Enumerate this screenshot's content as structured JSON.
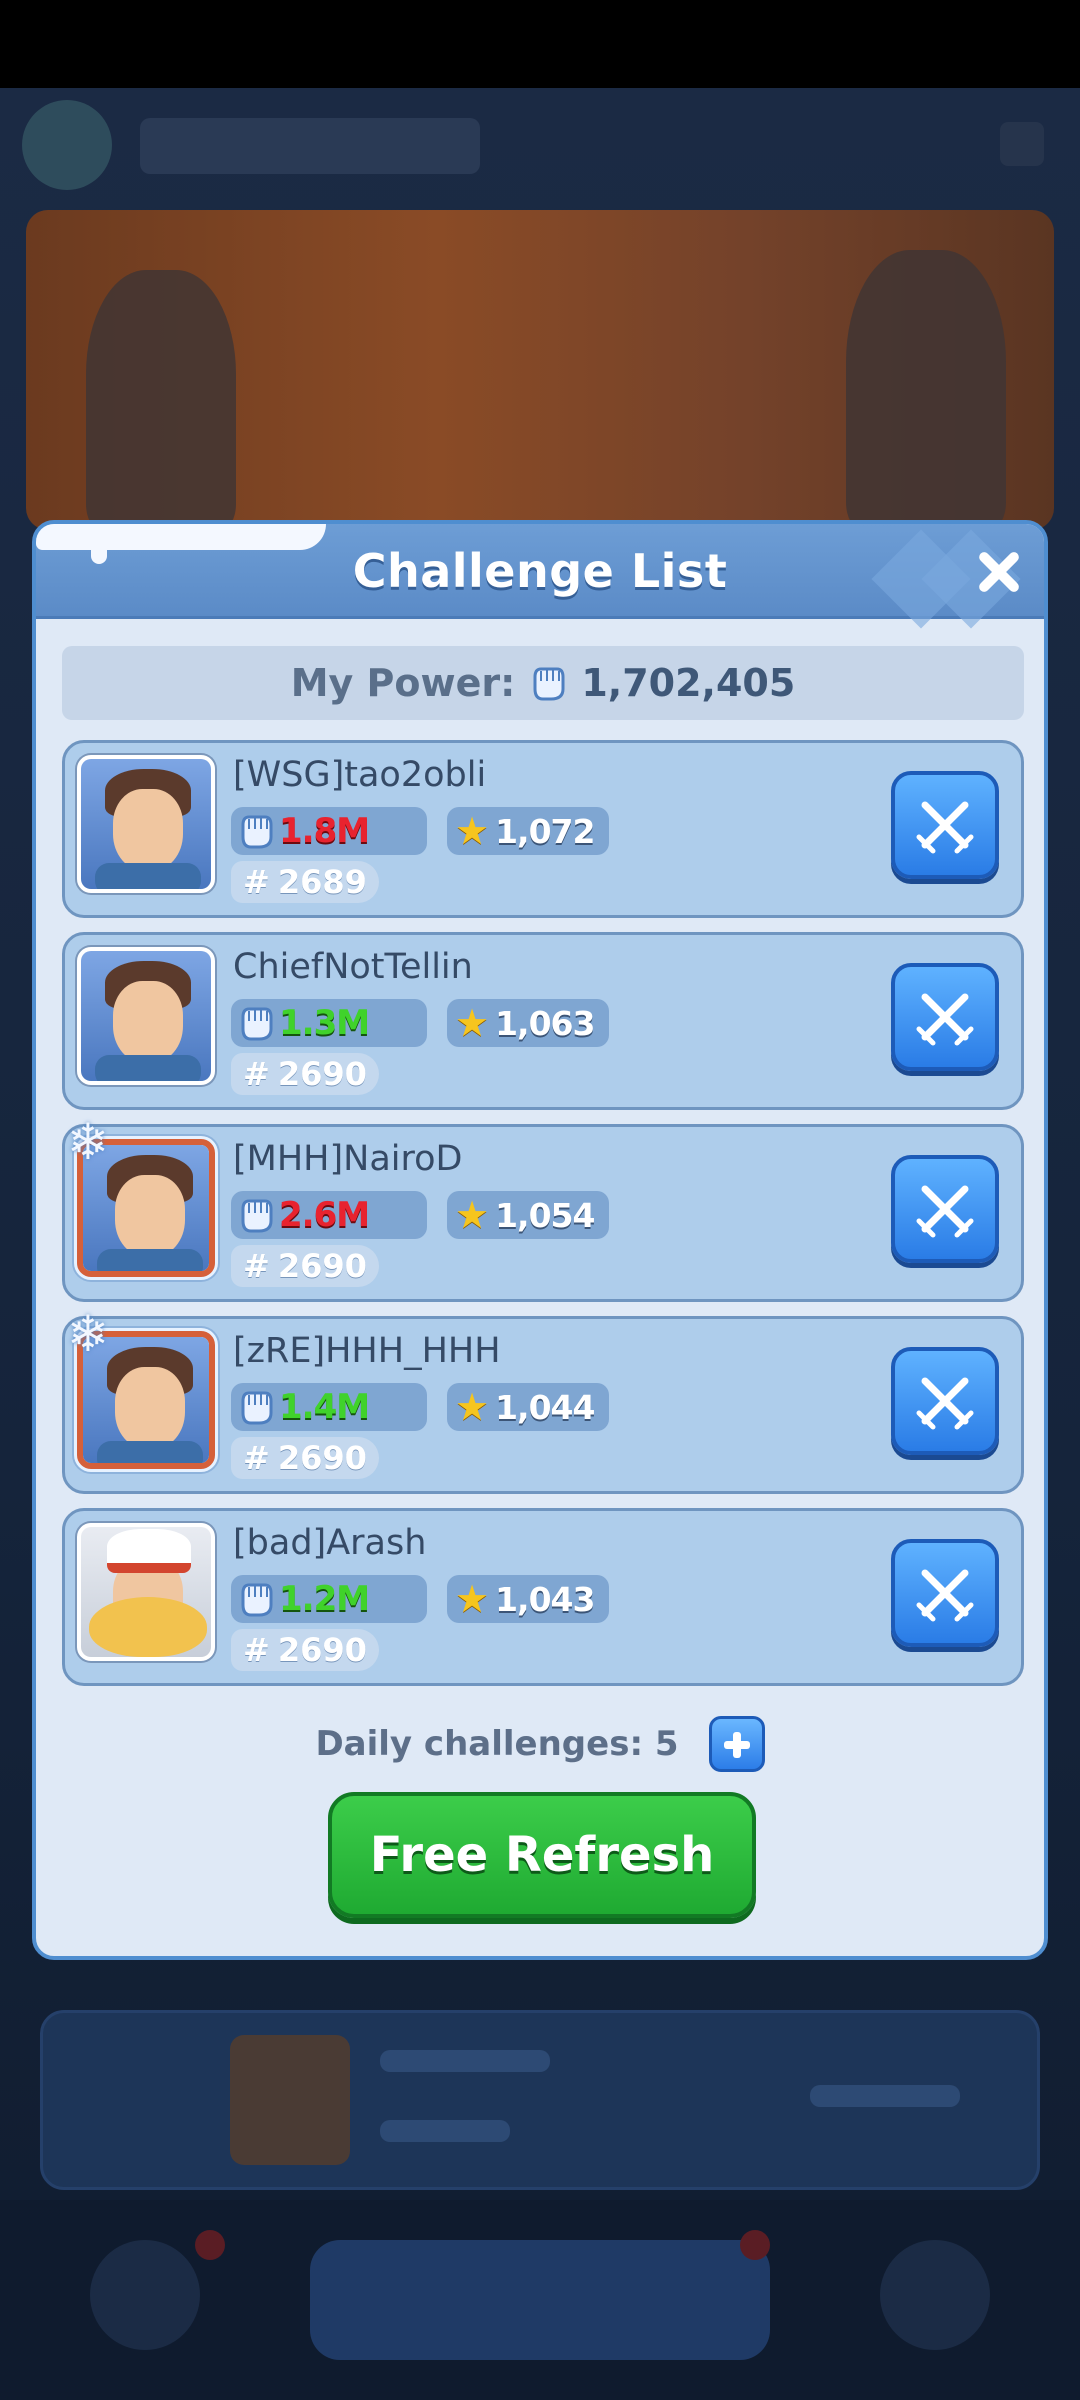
{
  "dialog": {
    "title": "Challenge List",
    "my_power_label": "My Power:",
    "my_power_value": "1,702,405",
    "daily_challenges": "Daily challenges: 5",
    "refresh_label": "Free Refresh"
  },
  "players": [
    {
      "name": "[WSG]tao2obli",
      "power": "1.8M",
      "power_color": "red",
      "stars": "1,072",
      "rank": "2689",
      "avatar": "hero",
      "frame": "plain"
    },
    {
      "name": "ChiefNotTellin",
      "power": "1.3M",
      "power_color": "green",
      "stars": "1,063",
      "rank": "2690",
      "avatar": "hero",
      "frame": "plain"
    },
    {
      "name": "[MHH]NairoD",
      "power": "2.6M",
      "power_color": "red",
      "stars": "1,054",
      "rank": "2690",
      "avatar": "hero",
      "frame": "frost"
    },
    {
      "name": "[zRE]HHH_HHH",
      "power": "1.4M",
      "power_color": "green",
      "stars": "1,044",
      "rank": "2690",
      "avatar": "hero",
      "frame": "frost"
    },
    {
      "name": "[bad]Arash",
      "power": "1.2M",
      "power_color": "green",
      "stars": "1,043",
      "rank": "2690",
      "avatar": "chef",
      "frame": "plain"
    }
  ],
  "icons": {
    "power": "fist-icon",
    "stars": "star-icon",
    "rank": "hash-icon",
    "fight": "crossed-swords-icon",
    "close": "close-icon",
    "add": "plus-icon"
  },
  "colors": {
    "power_red": "#e8232f",
    "power_green": "#40d22b",
    "refresh_button": "#2fbf40",
    "fight_button": "#3b8ff0"
  }
}
